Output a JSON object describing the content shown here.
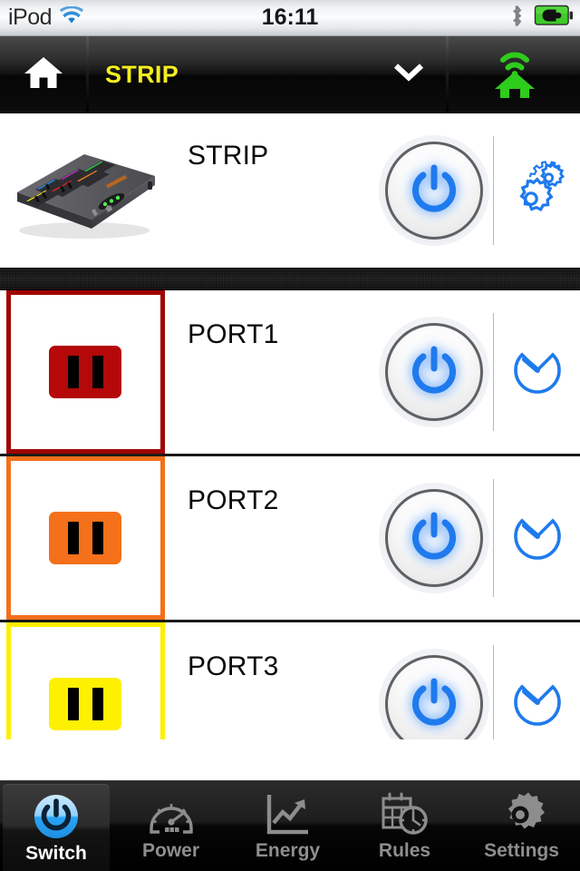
{
  "statusbar": {
    "carrier": "iPod",
    "time": "16:11",
    "wifi_icon": "wifi-icon",
    "bluetooth_icon": "bluetooth-icon",
    "battery_icon": "battery-charging-icon",
    "battery_color": "#3ecb2a"
  },
  "navbar": {
    "home_icon": "home-icon",
    "title": "STRIP",
    "title_color": "#f5ee20",
    "chevron_icon": "chevron-down-icon",
    "wifi_home_icon": "wifi-home-icon",
    "wifi_home_color": "#2ecc1b"
  },
  "rows": [
    {
      "name": "STRIP",
      "thumb_type": "power-strip-photo",
      "power_state": "on",
      "power_icon": "power-button",
      "action_icon": "gears-icon",
      "accent": "#000000"
    },
    {
      "name": "PORT1",
      "thumb_type": "outlet",
      "power_state": "on",
      "power_icon": "power-button",
      "action_icon": "timer-icon",
      "accent": "#a00505"
    },
    {
      "name": "PORT2",
      "thumb_type": "outlet",
      "power_state": "on",
      "power_icon": "power-button",
      "action_icon": "timer-icon",
      "accent": "#f4701a"
    },
    {
      "name": "PORT3",
      "thumb_type": "outlet",
      "power_state": "on",
      "power_icon": "power-button",
      "action_icon": "timer-icon",
      "accent": "#fdf000"
    }
  ],
  "colors": {
    "accent_blue": "#1f7aed",
    "power_glow": "#2a82f5",
    "list_bg": "#ffffff",
    "band": "#151515"
  },
  "tabbar": {
    "items": [
      {
        "label": "Switch",
        "icon": "power-circle-icon",
        "active": true
      },
      {
        "label": "Power",
        "icon": "gauge-icon",
        "active": false
      },
      {
        "label": "Energy",
        "icon": "line-chart-icon",
        "active": false
      },
      {
        "label": "Rules",
        "icon": "calendar-clock-icon",
        "active": false
      },
      {
        "label": "Settings",
        "icon": "gear-icon",
        "active": false
      }
    ]
  }
}
